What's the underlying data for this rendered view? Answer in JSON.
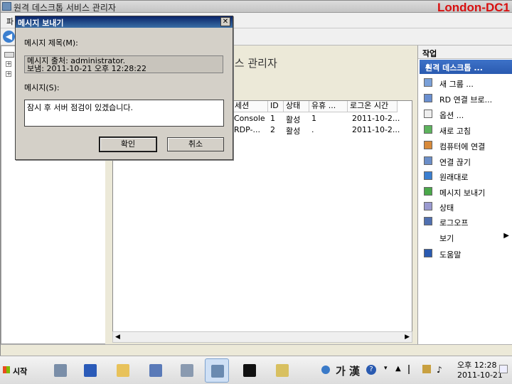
{
  "window": {
    "title": "원격 데스크톱 서비스 관리자",
    "server_label": "London-DC1",
    "menu_first": "파",
    "heading": "비스 관리자"
  },
  "sessions": {
    "columns": [
      "세션",
      "ID",
      "상태",
      "유휴 ...",
      "로그온 시간"
    ],
    "rows": [
      [
        "Console",
        "1",
        "활성",
        "1",
        "2011-10-2..."
      ],
      [
        "RDP-...",
        "2",
        "활성",
        ".",
        "2011-10-2..."
      ]
    ]
  },
  "actions": {
    "header": "작업",
    "section": "원격 데스크톱 ...",
    "items": [
      {
        "label": "새 그룹 ...",
        "icon": "group-icon"
      },
      {
        "label": "RD 연결 브로...",
        "icon": "broker-icon"
      },
      {
        "label": "옵션 ...",
        "icon": "options-icon"
      },
      {
        "label": "새로 고침",
        "icon": "refresh-icon"
      },
      {
        "label": "컴퓨터에 연결",
        "icon": "connect-icon"
      },
      {
        "label": "연결 끊기",
        "icon": "disconnect-icon"
      },
      {
        "label": "원래대로",
        "icon": "reset-icon"
      },
      {
        "label": "메시지 보내기",
        "icon": "message-icon"
      },
      {
        "label": "상태",
        "icon": "status-icon"
      },
      {
        "label": "로그오프",
        "icon": "logoff-icon"
      },
      {
        "label": "보기",
        "icon": ""
      },
      {
        "label": "도움말",
        "icon": "help-icon"
      }
    ]
  },
  "dialog": {
    "title": "메시지 보내기",
    "close": "✕",
    "title_label": "메시지 제목(M):",
    "title_line1": "메시지 출처: administrator.",
    "title_line2": "보냄: 2011-10-21 오후 12:28:22",
    "message_label": "메시지(S):",
    "message_value": "잠시 후 서버 점검이 있겠습니다.",
    "ok": "확인",
    "cancel": "취소"
  },
  "taskbar": {
    "start": "시작",
    "ime": "가 漢",
    "time": "오후 12:28",
    "date": "2011-10-21"
  }
}
